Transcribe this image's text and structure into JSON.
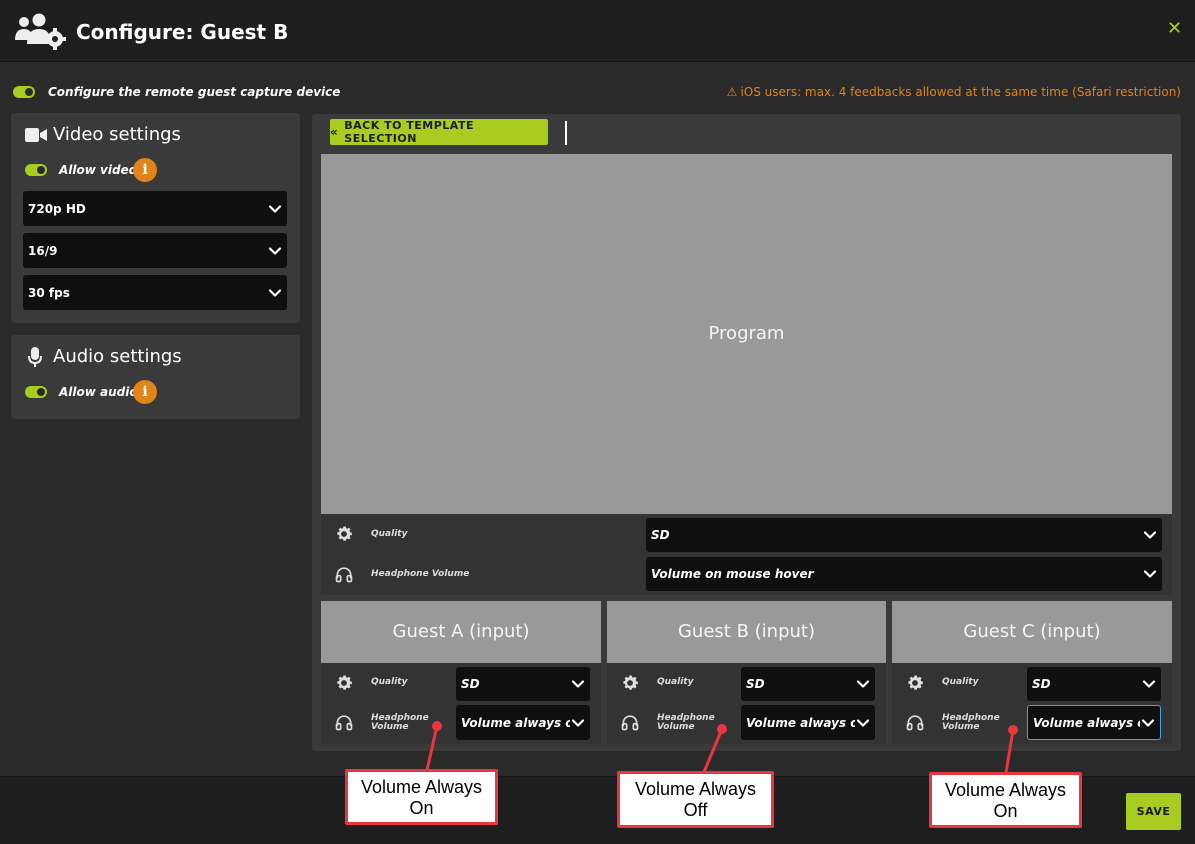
{
  "header": {
    "title": "Configure: Guest B",
    "close_label": "✕"
  },
  "configure_toggle_label": "Configure the remote guest capture device",
  "ios_warning": "iOS users: max. 4 feedbacks allowed at the same time (Safari restriction)",
  "video_settings": {
    "title": "Video settings",
    "allow_label": "Allow video",
    "resolution": "720p HD",
    "aspect_ratio": "16/9",
    "framerate": "30 fps"
  },
  "audio_settings": {
    "title": "Audio settings",
    "allow_label": "Allow audio"
  },
  "back_button_label": "BACK TO TEMPLATE SELECTION",
  "program": {
    "label": "Program",
    "quality_label": "Quality",
    "quality_value": "SD",
    "headphone_label": "Headphone Volume",
    "headphone_value": "Volume on mouse hover"
  },
  "guests": [
    {
      "label": "Guest A (input)",
      "quality_label": "Quality",
      "quality_value": "SD",
      "headphone_label_1": "Headphone",
      "headphone_label_2": "Volume",
      "headphone_value": "Volume always on"
    },
    {
      "label": "Guest B (input)",
      "quality_label": "Quality",
      "quality_value": "SD",
      "headphone_label_1": "Headphone",
      "headphone_label_2": "Volume",
      "headphone_value": "Volume always off"
    },
    {
      "label": "Guest C (input)",
      "quality_label": "Quality",
      "quality_value": "SD",
      "headphone_label_1": "Headphone",
      "headphone_label_2": "Volume",
      "headphone_value": "Volume always on"
    }
  ],
  "callouts": [
    {
      "line1": "Volume Always",
      "line2": "On"
    },
    {
      "line1": "Volume Always",
      "line2": "Off"
    },
    {
      "line1": "Volume Always",
      "line2": "On"
    }
  ],
  "save_label": "SAVE",
  "colors": {
    "accent": "#a8cc1f",
    "warning": "#e0851b",
    "callout": "#e8373f",
    "background": "#2a2a2a",
    "panel": "#3a3a3a",
    "preview": "#999999"
  }
}
